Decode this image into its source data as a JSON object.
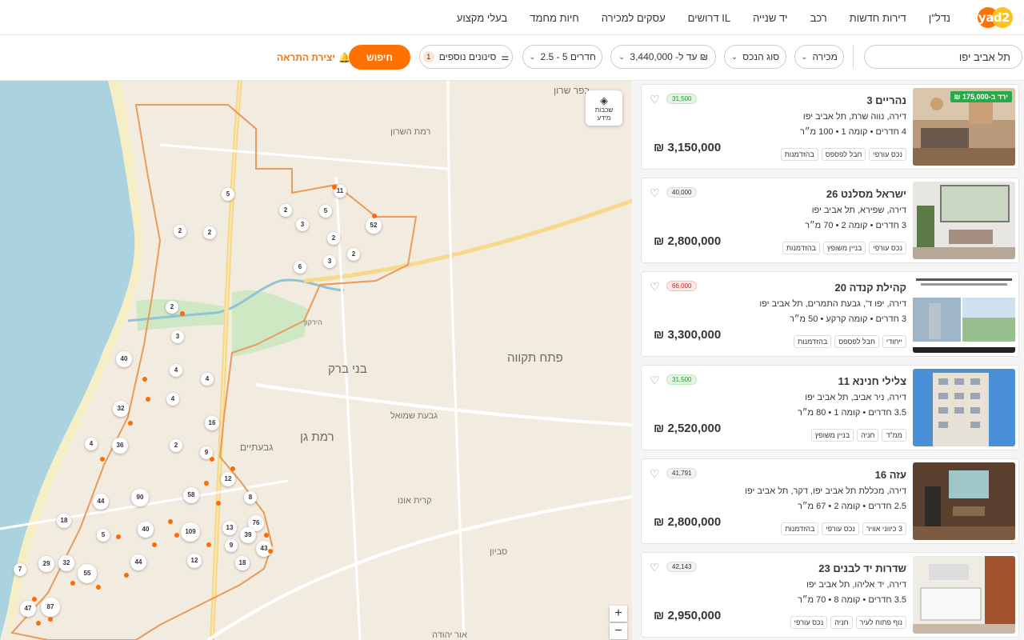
{
  "nav": {
    "logo": "yad2",
    "items": [
      "נדל\"ן",
      "דירות חדשות",
      "רכב",
      "יד שנייה",
      "דרושים IL",
      "עסקים למכירה",
      "חיות מחמד",
      "בעלי מקצוע"
    ]
  },
  "search": {
    "city_value": "תל אביב יפו",
    "deal_type": "מכירה",
    "property_type": "סוג הנכס",
    "price": "עד ל- 3,440,000 ₪",
    "rooms": "2.5 - 5 חדרים",
    "more_filters": "סינונים נוספים",
    "more_filters_count": "1",
    "search_button": "חיפוש",
    "create_alert": "יצירת התראה"
  },
  "map": {
    "layers_label": "שכבות מידע",
    "zoom_in": "+",
    "zoom_out": "−",
    "labels": [
      "כפר שרון",
      "רמת השרון",
      "בני ברק",
      "פתח תקווה",
      "רמת גן",
      "גבעתיים",
      "קרית אונו",
      "סביון",
      "גבעת שמואל",
      "אור יהודה",
      "הירקון"
    ],
    "clusters": [
      "11",
      "5",
      "2",
      "5",
      "2",
      "3",
      "52",
      "2",
      "2",
      "2",
      "6",
      "3",
      "2",
      "3",
      "40",
      "4",
      "4",
      "4",
      "32",
      "16",
      "36",
      "4",
      "2",
      "9",
      "12",
      "8",
      "58",
      "44",
      "90",
      "18",
      "76",
      "40",
      "109",
      "13",
      "39",
      "5",
      "9",
      "43",
      "12",
      "18",
      "44",
      "29",
      "32",
      "55",
      "7",
      "87",
      "47"
    ]
  },
  "listings": [
    {
      "title": "נהריים 3",
      "sub": "דירה, נווה שרת, תל אביב יפו",
      "details": "4 חדרים • קומה 1 • 100 מ״ר",
      "tags": [
        "נכס עורפי",
        "חבל לפספס",
        "בהזדמנות"
      ],
      "price": "3,150,000 ₪",
      "badge": "31,500",
      "badge_color": "#e3f7e4",
      "price_drop": "ירד ב-175,000 ₪"
    },
    {
      "title": "ישראל מסלנט 26",
      "sub": "דירה, שפירא, תל אביב יפו",
      "details": "3 חדרים • קומה 2 • 70 מ״ר",
      "tags": [
        "נכס עורפי",
        "בניין משופץ",
        "בהזדמנות"
      ],
      "price": "2,800,000 ₪",
      "badge": "40,000",
      "badge_color": "#f2f2f2",
      "price_drop": ""
    },
    {
      "title": "קהילת קנדה 20",
      "sub": "דירה, יפו ד', גבעת התמרים, תל אביב יפו",
      "details": "3 חדרים • קומה קרקע • 50 מ״ר",
      "tags": [
        "ייחודי",
        "חבל לפספס",
        "בהזדמנות"
      ],
      "price": "3,300,000 ₪",
      "badge": "66,000",
      "badge_color": "#fde8e8",
      "price_drop": ""
    },
    {
      "title": "צלילי חנינא 11",
      "sub": "דירה, ניר אביב, תל אביב יפו",
      "details": "3.5 חדרים • קומה 1 • 80 מ״ר",
      "tags": [
        "ממ\"ד",
        "חניה",
        "בניין משופץ"
      ],
      "price": "2,520,000 ₪",
      "badge": "31,500",
      "badge_color": "#e3f7e4",
      "price_drop": ""
    },
    {
      "title": "עזה 16",
      "sub": "דירה, מכללת תל אביב יפו, דקר, תל אביב יפו",
      "details": "2.5 חדרים • קומה 2 • 67 מ״ר",
      "tags": [
        "3 כיווני אוויר",
        "נכס עורפי",
        "בהזדמנות"
      ],
      "price": "2,800,000 ₪",
      "badge": "41,791",
      "badge_color": "#f2f2f2",
      "price_drop": ""
    },
    {
      "title": "שדרות יד לבנים 23",
      "sub": "דירה, יד אליהו, תל אביב יפו",
      "details": "3.5 חדרים • קומה 8 • 70 מ״ר",
      "tags": [
        "נוף פתוח לעיר",
        "חניה",
        "נכס עורפי"
      ],
      "price": "2,950,000 ₪",
      "badge": "42,143",
      "badge_color": "#f2f2f2",
      "price_drop": ""
    }
  ]
}
